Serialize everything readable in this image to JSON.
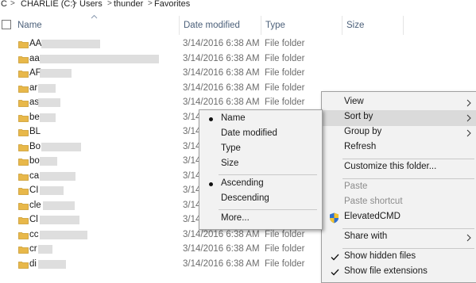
{
  "breadcrumb": {
    "items": [
      "C",
      "CHARLIE (C:)",
      "Users",
      "thunder",
      "Favorites"
    ]
  },
  "columns": {
    "name": "Name",
    "date_modified": "Date modified",
    "type": "Type",
    "size": "Size"
  },
  "files": [
    {
      "name": "AA",
      "date": "3/14/2016 6:38 AM",
      "type": "File folder"
    },
    {
      "name": "aa",
      "date": "3/14/2016 6:38 AM",
      "type": "File folder"
    },
    {
      "name": "AF",
      "date": "3/14/2016 6:38 AM",
      "type": "File folder"
    },
    {
      "name": "ar",
      "date": "3/14/2016 6:38 AM",
      "type": "File folder"
    },
    {
      "name": "as",
      "date": "3/14/2016 6:38 AM",
      "type": "File folder"
    },
    {
      "name": "be",
      "date": "3/14/2016 6:38 AM",
      "type": "File folder"
    },
    {
      "name": "BL",
      "date": "3/14/2016 6:38 AM",
      "type": "File folder"
    },
    {
      "name": "Bo",
      "date": "3/14/2016 6:38 AM",
      "type": "File folder"
    },
    {
      "name": "bo",
      "date": "3/14/2016 6:38 AM",
      "type": "File folder"
    },
    {
      "name": "ca",
      "date": "3/14/2016 6:38 AM",
      "type": "File folder"
    },
    {
      "name": "CI",
      "date": "3/14/2016 6:38 AM",
      "type": "File folder"
    },
    {
      "name": "cle",
      "date": "3/14/2016 6:38 AM",
      "type": "File folder"
    },
    {
      "name": "Cl",
      "date": "3/14/2016 6:38 AM",
      "type": "File folder"
    },
    {
      "name": "cc",
      "date": "3/14/2016 6:38 AM",
      "type": "File folder"
    },
    {
      "name": "cr",
      "date": "3/14/2016 6:38 AM",
      "type": "File folder"
    },
    {
      "name": "di",
      "date": "3/14/2016 6:38 AM",
      "type": "File folder"
    }
  ],
  "context_menu": {
    "view": "View",
    "sort_by": "Sort by",
    "group_by": "Group by",
    "refresh": "Refresh",
    "customize": "Customize this folder...",
    "paste": "Paste",
    "paste_shortcut": "Paste shortcut",
    "elevated_cmd": "ElevatedCMD",
    "share_with": "Share with",
    "show_hidden": "Show hidden files",
    "show_ext": "Show file extensions"
  },
  "sort_submenu": {
    "name": "Name",
    "date_modified": "Date modified",
    "type": "Type",
    "size": "Size",
    "ascending": "Ascending",
    "descending": "Descending",
    "more": "More..."
  },
  "colors": {
    "header_text": "#4c607a",
    "folder": "#e8b84a",
    "highlight": "#dadada",
    "menu_bg": "#f2f2f2"
  }
}
